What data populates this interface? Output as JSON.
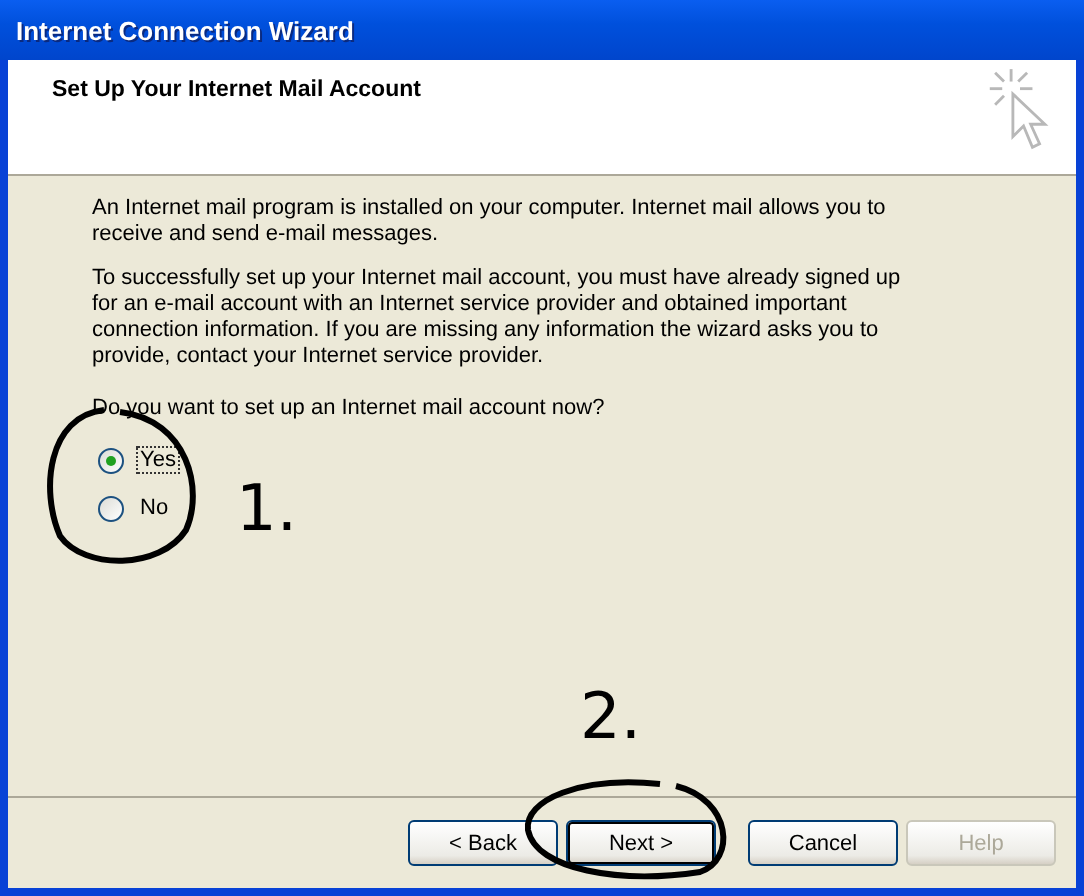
{
  "window": {
    "title": "Internet Connection Wizard"
  },
  "header": {
    "title": "Set Up Your Internet Mail Account"
  },
  "paragraphs": [
    "An Internet mail program is installed on your computer. Internet mail allows you to receive and send e-mail messages.",
    "To successfully set up your Internet mail account, you must have already signed up for an e-mail account with an Internet service provider and obtained important connection information. If you are missing any information the wizard asks you to provide, contact your Internet service provider."
  ],
  "question": "Do you want to set up an Internet mail account now?",
  "options": [
    {
      "label": "Yes",
      "selected": true,
      "focused": true
    },
    {
      "label": "No",
      "selected": false,
      "focused": false
    }
  ],
  "buttons": [
    {
      "label": "< Back",
      "disabled": false,
      "default": false
    },
    {
      "label": "Next >",
      "disabled": false,
      "default": true
    },
    {
      "label": "Cancel",
      "disabled": false,
      "default": false
    },
    {
      "label": "Help",
      "disabled": true,
      "default": false
    }
  ],
  "annotations": [
    {
      "label": "1."
    },
    {
      "label": "2."
    }
  ]
}
